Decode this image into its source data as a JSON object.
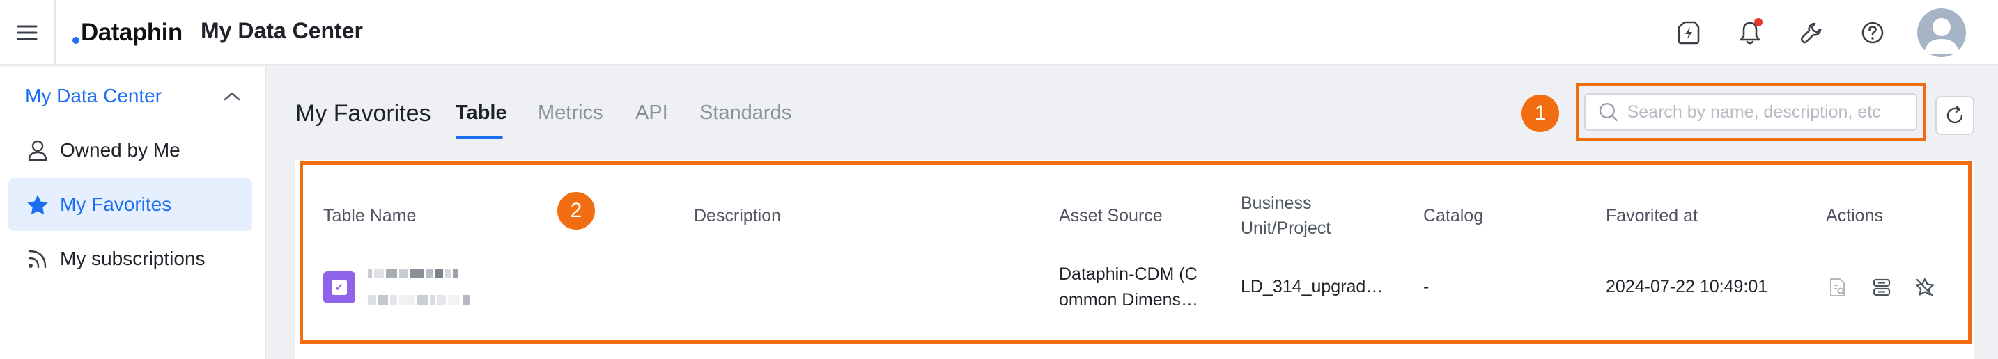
{
  "header": {
    "logo_text": "Dataphin",
    "app_title": "My Data Center",
    "icons": [
      "menu-icon",
      "lightning-badge-icon",
      "bell-icon",
      "wrench-icon",
      "help-icon"
    ],
    "avatar": "user-avatar"
  },
  "sidebar": {
    "section_label": "My Data Center",
    "items": [
      {
        "label": "Owned by Me",
        "icon": "user-icon",
        "active": false
      },
      {
        "label": "My Favorites",
        "icon": "star-icon",
        "active": true
      },
      {
        "label": "My subscriptions",
        "icon": "rss-icon",
        "active": false
      }
    ]
  },
  "main": {
    "title": "My Favorites",
    "tabs": [
      {
        "label": "Table",
        "active": true
      },
      {
        "label": "Metrics",
        "active": false
      },
      {
        "label": "API",
        "active": false
      },
      {
        "label": "Standards",
        "active": false
      }
    ],
    "search": {
      "placeholder": "Search by name, description, etc",
      "value": ""
    },
    "annotations": [
      "1",
      "2"
    ]
  },
  "table": {
    "columns": [
      {
        "label": "Table Name"
      },
      {
        "label": "Description"
      },
      {
        "label": "Asset Source"
      },
      {
        "label": "Business\nUnit/Project"
      },
      {
        "label": "Catalog"
      },
      {
        "label": "Favorited at"
      },
      {
        "label": "Actions"
      }
    ],
    "rows": [
      {
        "description": "",
        "asset_source": "Dataphin-CDM (C\nommon Dimens…",
        "business_unit": "LD_314_upgrad…",
        "catalog": "-",
        "favorited_at": "2024-07-22 10:49:01",
        "actions": [
          "details-icon",
          "table-structure-icon",
          "unfavorite-icon"
        ]
      }
    ]
  },
  "colors": {
    "accent": "#1d6ff2",
    "annotation": "#f26d0f",
    "table_icon": "#8f63ea",
    "notification": "#e8352e"
  }
}
